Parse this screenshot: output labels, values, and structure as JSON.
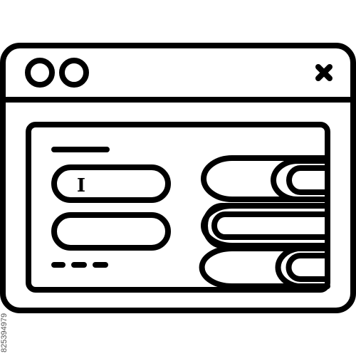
{
  "icon": {
    "name": "browser-login-form-books-icon",
    "stroke_color": "#000000",
    "background_color": "#ffffff",
    "window": {
      "dots": [
        "window-dot-icon",
        "window-dot-icon"
      ],
      "close_icon": "close-icon"
    },
    "form": {
      "title_line_icon": "title-line-icon",
      "text_cursor_glyph": "I",
      "input_fields": [
        "input-field",
        "input-field"
      ],
      "dash_link_icon": "dashed-link-icon"
    },
    "books_stack_count": 3
  },
  "watermark": {
    "stock_id": "825394979"
  }
}
